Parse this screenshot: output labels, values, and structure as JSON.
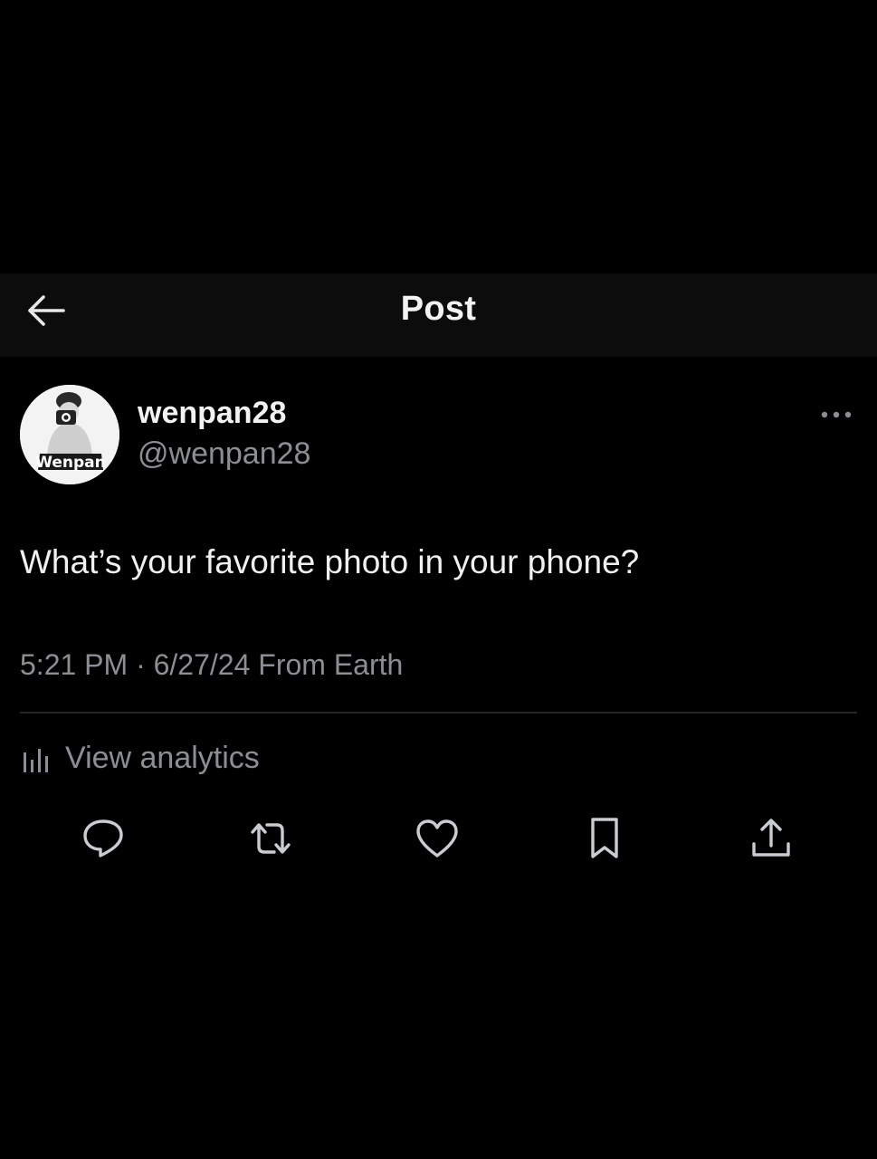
{
  "header": {
    "title": "Post",
    "back_icon": "arrow-left-icon"
  },
  "author": {
    "display_name": "wenpan28",
    "handle": "@wenpan28",
    "avatar_watermark": "Wenpan"
  },
  "post": {
    "text": "What’s your favorite photo in your phone?",
    "meta": "5:21 PM · 6/27/24 From Earth"
  },
  "analytics": {
    "label": "View analytics",
    "icon": "bar-chart-icon"
  },
  "actions": [
    {
      "name": "reply",
      "icon": "reply-icon"
    },
    {
      "name": "repost",
      "icon": "repost-icon"
    },
    {
      "name": "like",
      "icon": "heart-icon"
    },
    {
      "name": "bookmark",
      "icon": "bookmark-icon"
    },
    {
      "name": "share",
      "icon": "share-icon"
    }
  ],
  "colors": {
    "background": "#000000",
    "header_background": "#0c0c0c",
    "primary_text": "#f2f2f2",
    "secondary_text": "#8b8f93",
    "icon": "#c9cdd1"
  }
}
